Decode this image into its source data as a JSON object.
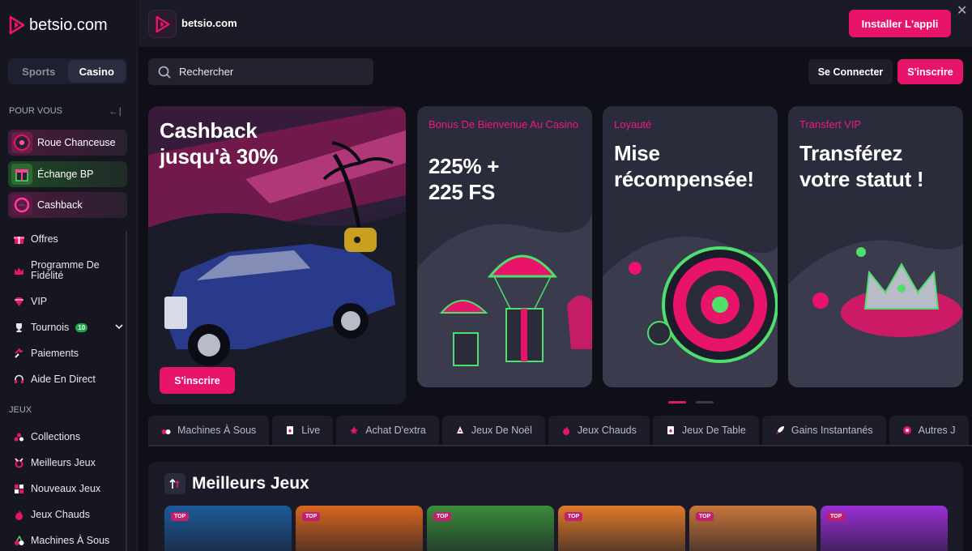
{
  "brand": {
    "name": "betsio.com"
  },
  "sidebar": {
    "switch": {
      "sports": "Sports",
      "casino": "Casino"
    },
    "for_you": "POUR VOUS",
    "collapse_glyph": "←∣",
    "promos": [
      {
        "label": "Roue Chanceuse"
      },
      {
        "label": "Échange BP"
      },
      {
        "label": "Cashback"
      }
    ],
    "items": [
      {
        "label": "Offres",
        "icon": "gift-icon"
      },
      {
        "label": "Programme De Fidélité",
        "icon": "crown-icon"
      },
      {
        "label": "VIP",
        "icon": "diamond-icon"
      },
      {
        "label": "Tournois",
        "icon": "trophy-icon",
        "badge": "10"
      },
      {
        "label": "Paiements",
        "icon": "payments-icon"
      },
      {
        "label": "Aide En Direct",
        "icon": "headset-icon"
      }
    ],
    "games_head": "JEUX",
    "games": [
      {
        "label": "Collections",
        "icon": "collections-icon"
      },
      {
        "label": "Meilleurs Jeux",
        "icon": "best-games-icon"
      },
      {
        "label": "Nouveaux Jeux",
        "icon": "new-games-icon"
      },
      {
        "label": "Jeux Chauds",
        "icon": "flame-icon"
      },
      {
        "label": "Machines À Sous",
        "icon": "slots-icon"
      }
    ]
  },
  "topbar": {
    "app_name": "betsio.com",
    "install": "Installer L'appli",
    "close": "✕"
  },
  "search": {
    "placeholder": "Rechercher"
  },
  "auth": {
    "login": "Se Connecter",
    "signup": "S'inscrire"
  },
  "banners": [
    {
      "title_line1": "Cashback",
      "title_line2": "jusqu'à 30%",
      "cta": "S'inscrire"
    },
    {
      "subtitle": "Bonus De Bienvenue Au Casino",
      "title_line1": "225% +",
      "title_line2": "225 FS"
    },
    {
      "subtitle": "Loyauté",
      "title_line1": "Mise",
      "title_line2": "récompensée!"
    },
    {
      "subtitle": "Transfert VIP",
      "title_line1": "Transférez",
      "title_line2": "votre statut !"
    }
  ],
  "categories": [
    {
      "label": "Machines À Sous"
    },
    {
      "label": "Live"
    },
    {
      "label": "Achat D'extra"
    },
    {
      "label": "Jeux De Noël"
    },
    {
      "label": "Jeux Chauds"
    },
    {
      "label": "Jeux De Table"
    },
    {
      "label": "Gains Instantanés"
    },
    {
      "label": "Autres J"
    }
  ],
  "best_games": {
    "title": "Meilleurs Jeux",
    "tag": "TOP",
    "colors": [
      "#1d5a9a",
      "#d9661f",
      "#3a8c3a",
      "#e07a2a",
      "#c8763a",
      "#9b2fd6"
    ]
  },
  "colors": {
    "accent": "#e8146c",
    "bg": "#0f1017",
    "panel": "#1a1b26"
  }
}
